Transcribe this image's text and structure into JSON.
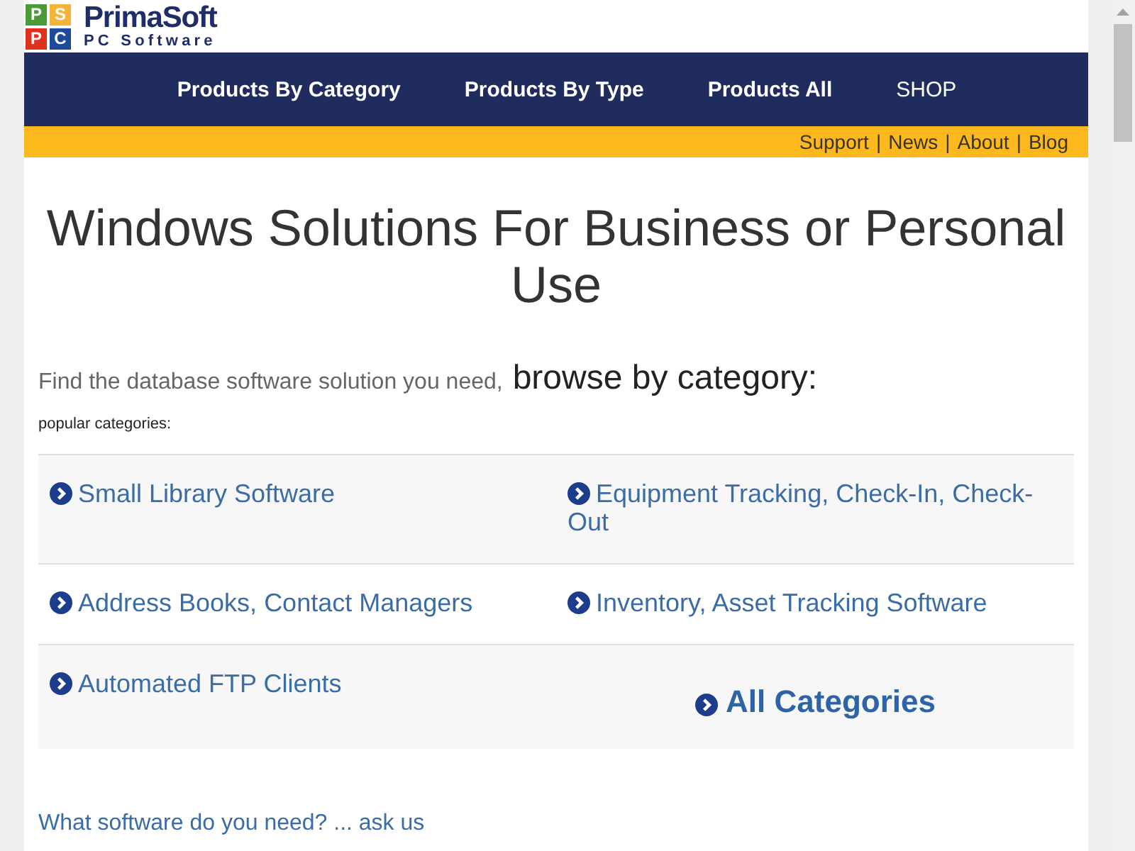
{
  "logo": {
    "tiles": [
      {
        "letter": "P",
        "color": "#4a9a3a"
      },
      {
        "letter": "S",
        "color": "#f4b43a"
      },
      {
        "letter": "P",
        "color": "#e0301e"
      },
      {
        "letter": "C",
        "color": "#1e4a9a"
      }
    ],
    "name": "PrimaSoft",
    "tagline": "PC Software"
  },
  "nav": [
    {
      "label": "Products By Category",
      "kind": "menu"
    },
    {
      "label": "Products By Type",
      "kind": "menu"
    },
    {
      "label": "Products All",
      "kind": "menu"
    },
    {
      "label": "SHOP",
      "kind": "shop"
    }
  ],
  "utility_links": [
    {
      "label": "Support",
      "separator": "|"
    },
    {
      "label": "News",
      "separator": "|"
    },
    {
      "label": "About",
      "separator": "|"
    },
    {
      "label": "Blog"
    }
  ],
  "heading": "Windows Solutions For Business or Personal Use",
  "intro": {
    "text": "Find the database software solution you need,",
    "emphasis": "browse by category:"
  },
  "popular_label": "popular categories:",
  "categories": {
    "rows": [
      {
        "cells": [
          {
            "kind": "link",
            "label": "Small Library Software"
          },
          {
            "kind": "link",
            "label": "Equipment Tracking, Check-In, Check-Out"
          }
        ]
      },
      {
        "cells": [
          {
            "kind": "link",
            "label": "Address Books, Contact Managers"
          },
          {
            "kind": "link",
            "label": "Inventory, Asset Tracking Software"
          }
        ]
      },
      {
        "cells": [
          {
            "kind": "link",
            "label": "Automated FTP Clients"
          },
          {
            "kind": "all",
            "label": "All Categories"
          }
        ]
      }
    ]
  },
  "ask_link": "What software do you need? ... ask us"
}
